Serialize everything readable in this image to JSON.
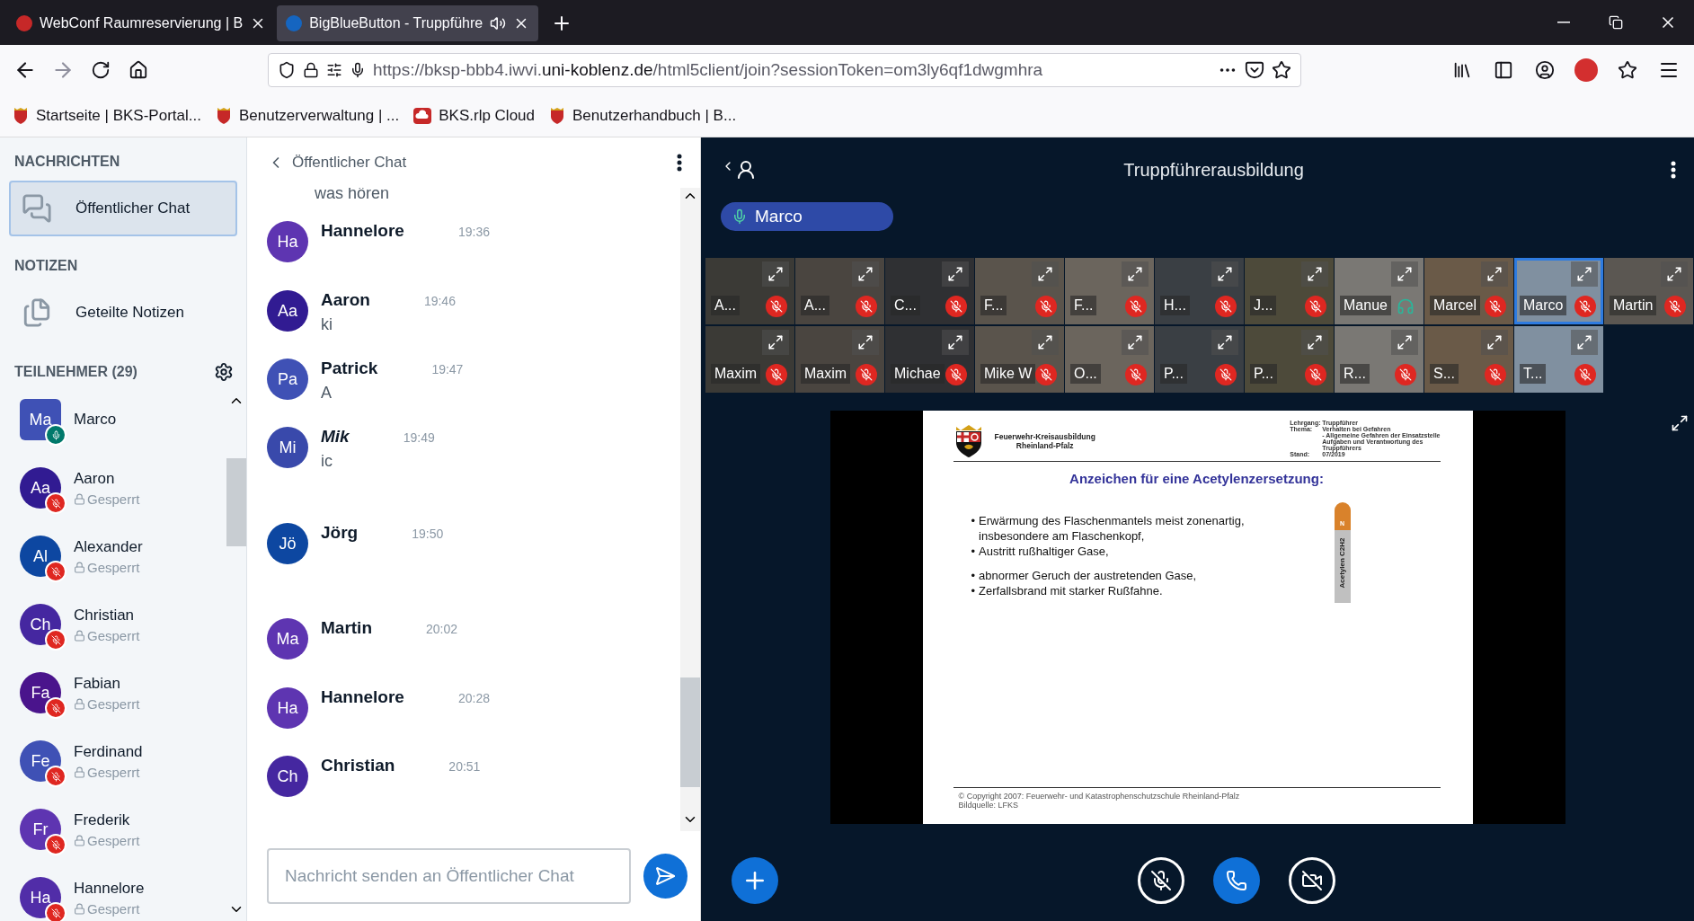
{
  "browser": {
    "tabs": [
      {
        "title": "WebConf Raumreservierung | B",
        "selected": false,
        "audio": false
      },
      {
        "title": "BigBlueButton - Truppführe",
        "selected": true,
        "audio": true
      }
    ],
    "url": "https://bksp-bbb4.iwvi.**uni-koblenz.de**/html5client/join?sessionToken=om3ly6qf1dwgmhra",
    "bookmarks": [
      {
        "label": "Startseite | BKS-Portal...",
        "kind": "crest"
      },
      {
        "label": "Benutzerverwaltung | ...",
        "kind": "crest"
      },
      {
        "label": "BKS.rlp Cloud",
        "kind": "cloud"
      },
      {
        "label": "Benutzerhandbuch | B...",
        "kind": "crest"
      }
    ]
  },
  "sidebar": {
    "messages_heading": "NACHRICHTEN",
    "chats": [
      {
        "label": "Öffentlicher Chat",
        "selected": true
      }
    ],
    "notes_heading": "NOTIZEN",
    "notes": [
      {
        "label": "Geteilte Notizen"
      }
    ],
    "participants_heading": "TEILNEHMER (29)",
    "participants": [
      {
        "initials": "Ma",
        "name": "Marco",
        "presenter": true,
        "muted": false,
        "color": "#3f51b5"
      },
      {
        "initials": "Aa",
        "name": "Aaron",
        "presenter": false,
        "muted": true,
        "status": "Gesperrt",
        "color": "#311b92"
      },
      {
        "initials": "Al",
        "name": "Alexander",
        "presenter": false,
        "muted": true,
        "status": "Gesperrt",
        "color": "#0d47a1"
      },
      {
        "initials": "Ch",
        "name": "Christian",
        "presenter": false,
        "muted": true,
        "status": "Gesperrt",
        "color": "#4527a0"
      },
      {
        "initials": "Fa",
        "name": "Fabian",
        "presenter": false,
        "muted": true,
        "status": "Gesperrt",
        "color": "#4a148c"
      },
      {
        "initials": "Fe",
        "name": "Ferdinand",
        "presenter": false,
        "muted": true,
        "status": "Gesperrt",
        "color": "#3f51b5"
      },
      {
        "initials": "Fr",
        "name": "Frederik",
        "presenter": false,
        "muted": true,
        "status": "Gesperrt",
        "color": "#5e35b1"
      },
      {
        "initials": "Ha",
        "name": "Hannelore",
        "presenter": false,
        "muted": true,
        "status": "Gesperrt",
        "color": "#512da8"
      }
    ]
  },
  "chat": {
    "title": "Öffentlicher Chat",
    "cut_text": "was hören",
    "messages": [
      {
        "initials": "Ha",
        "name": "Hannelore",
        "time": "19:36",
        "color": "#5e35b1",
        "italic": false
      },
      {
        "initials": "Aa",
        "name": "Aaron",
        "time": "19:46",
        "text": "ki",
        "color": "#311b92",
        "italic": false
      },
      {
        "initials": "Pa",
        "name": "Patrick",
        "time": "19:47",
        "text": "A",
        "color": "#3f51b5",
        "italic": false
      },
      {
        "initials": "Mi",
        "name": "Mik",
        "time": "19:49",
        "text": "ic",
        "color": "#3949ab",
        "italic": true
      },
      {
        "initials": "Jö",
        "name": "Jörg",
        "time": "19:50",
        "color": "#0d47a1",
        "italic": false
      },
      {
        "initials": "Ma",
        "name": "Martin",
        "time": "20:02",
        "color": "#5e35b1",
        "italic": false
      },
      {
        "initials": "Ha",
        "name": "Hannelore",
        "time": "20:28",
        "color": "#5e35b1",
        "italic": false
      },
      {
        "initials": "Ch",
        "name": "Christian",
        "time": "20:51",
        "color": "#4527a0",
        "italic": false
      }
    ],
    "placeholder": "Nachricht senden an Öffentlicher Chat"
  },
  "meeting": {
    "title": "Truppführerausbildung",
    "talker": "Marco",
    "tiles": [
      {
        "name": "A...",
        "muted": true,
        "talking": false
      },
      {
        "name": "A...",
        "muted": true,
        "talking": false
      },
      {
        "name": "C...",
        "muted": true,
        "talking": false
      },
      {
        "name": "F...",
        "muted": true,
        "talking": false
      },
      {
        "name": "F...",
        "muted": true,
        "talking": false
      },
      {
        "name": "H...",
        "muted": true,
        "talking": false
      },
      {
        "name": "J...",
        "muted": true,
        "talking": false
      },
      {
        "name": "Manue",
        "muted": false,
        "talking": false
      },
      {
        "name": "Marcel",
        "muted": true,
        "talking": false
      },
      {
        "name": "Marco",
        "muted": true,
        "talking": true
      },
      {
        "name": "Martin",
        "muted": true,
        "talking": false
      },
      {
        "name": "Maxim",
        "muted": true,
        "talking": false
      },
      {
        "name": "Maxim",
        "muted": true,
        "talking": false
      },
      {
        "name": "Michae",
        "muted": true,
        "talking": false
      },
      {
        "name": "Mike W",
        "muted": true,
        "talking": false
      },
      {
        "name": "O...",
        "muted": true,
        "talking": false
      },
      {
        "name": "P...",
        "muted": true,
        "talking": false
      },
      {
        "name": "P...",
        "muted": true,
        "talking": false
      },
      {
        "name": "R...",
        "muted": true,
        "talking": false
      },
      {
        "name": "S...",
        "muted": true,
        "talking": false
      },
      {
        "name": "T...",
        "muted": true,
        "talking": false
      }
    ],
    "slide": {
      "org": [
        "Feuerwehr-Kreisausbildung",
        "Rheinland-Pfalz"
      ],
      "meta": [
        {
          "label": "Lehrgang:",
          "value": "Truppführer"
        },
        {
          "label": "Thema:",
          "value": "Verhalten bei Gefahren"
        },
        {
          "value": "- Allgemeine Gefahren der Einsatzstelle"
        },
        {
          "value": "Aufgaben und Verantwortung des"
        },
        {
          "value": "Truppführers"
        },
        {
          "label": "Stand:",
          "value": "07/2019"
        }
      ],
      "title": "Anzeichen für eine Acetylenzersetzung:",
      "bullets": [
        {
          "marker": "•",
          "lines": [
            "Erwärmung des Flaschenmantels meist zonenartig,",
            "insbesondere am Flaschenkopf,"
          ]
        },
        {
          "marker": "•",
          "lines": [
            "Austritt rußhaltiger Gase,"
          ]
        },
        {
          "marker": "•",
          "lines": [
            "abnormer Geruch der austretenden Gase,"
          ]
        },
        {
          "marker": "•",
          "lines": [
            "Zerfallsbrand mit starker Rußfahne."
          ]
        }
      ],
      "cylinder_cap": "N",
      "cylinder_label": "Acetylen C2H2",
      "footer": [
        "© Copyright 2007: Feuerwehr- und Katastrophenschutzschule Rheinland-Pfalz",
        "Bildquelle: LFKS"
      ]
    }
  }
}
